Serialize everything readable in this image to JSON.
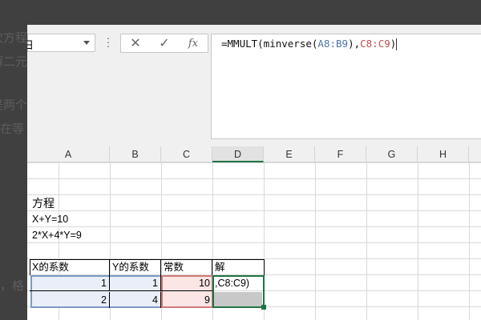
{
  "background_text": [
    "次方程",
    "解二元",
    "是两个",
    "在等",
    "格，"
  ],
  "name_box": {
    "value": "日"
  },
  "formula_bar": {
    "cancel_icon": "✕",
    "enter_icon": "✓",
    "fx_label": "fx",
    "formula_parts": [
      "=MMULT(minverse(",
      "A8:B9",
      "),",
      "C8:C9",
      ")"
    ]
  },
  "columns": [
    "A",
    "B",
    "C",
    "D",
    "E",
    "F",
    "G",
    "H"
  ],
  "cells": {
    "title": "方程",
    "eq1": "X+Y=10",
    "eq2": "2*X+4*Y=9",
    "headers": [
      "X的系数",
      "Y的系数",
      "常数",
      "解"
    ],
    "row1": [
      "1",
      "1",
      "10",
      ",C8:C9)"
    ],
    "row2": [
      "2",
      "4",
      "9",
      ""
    ]
  },
  "colors": {
    "range1": "#4b73ad",
    "range2": "#c0504d",
    "selection": "#217346"
  }
}
